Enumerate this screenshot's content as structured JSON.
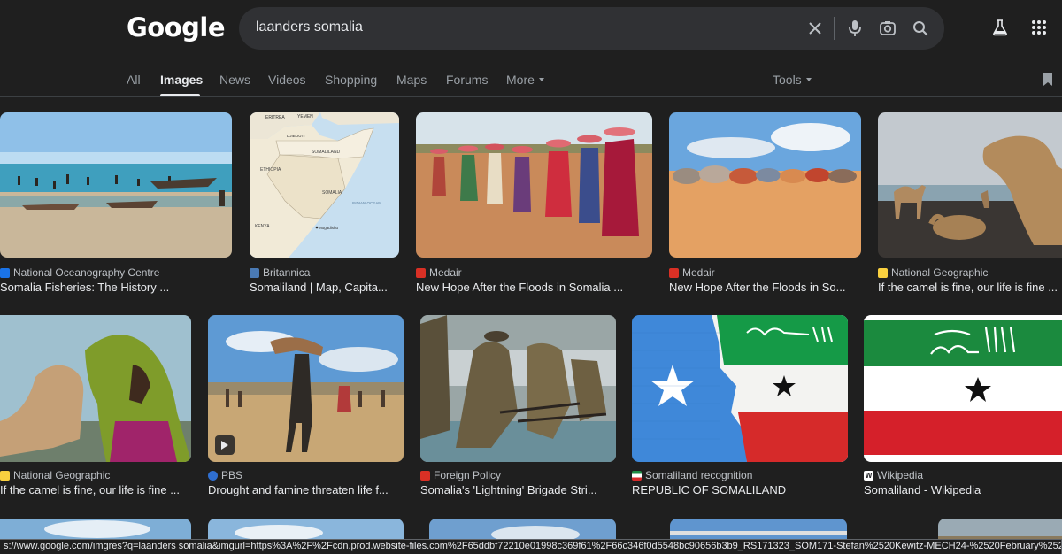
{
  "header": {
    "logo": "Google",
    "query": "laanders somalia"
  },
  "tabs": [
    {
      "label": "All"
    },
    {
      "label": "Images"
    },
    {
      "label": "News"
    },
    {
      "label": "Videos"
    },
    {
      "label": "Shopping"
    },
    {
      "label": "Maps"
    },
    {
      "label": "Forums"
    },
    {
      "label": "More"
    },
    {
      "label": "Tools"
    }
  ],
  "results": [
    {
      "source": "National Oceanography Centre",
      "title": "Somalia Fisheries: The History ...",
      "favicon_color": "#1a73e8"
    },
    {
      "source": "Britannica",
      "title": "Somaliland | Map, Capita...",
      "favicon_color": "#4a7ab5"
    },
    {
      "source": "Medair",
      "title": "New Hope After the Floods in Somalia ...",
      "favicon_color": "#d93025"
    },
    {
      "source": "Medair",
      "title": "New Hope After the Floods in So...",
      "favicon_color": "#d93025"
    },
    {
      "source": "National Geographic",
      "title": "If the camel is fine, our life is fine ...",
      "favicon_color": "#f9d03f"
    },
    {
      "source": "National Geographic",
      "title": "If the camel is fine, our life is fine ...",
      "favicon_color": "#f9d03f"
    },
    {
      "source": "PBS",
      "title": "Drought and famine threaten life f...",
      "favicon_color": "#2f6fd1"
    },
    {
      "source": "Foreign Policy",
      "title": "Somalia's 'Lightning' Brigade Stri...",
      "favicon_color": "#d93025"
    },
    {
      "source": "Somaliland recognition",
      "title": "REPUBLIC OF SOMALILAND",
      "favicon_color": "#1e8c45"
    },
    {
      "source": "Wikipedia",
      "title": "Somaliland - Wikipedia",
      "favicon_color": "#ffffff"
    }
  ],
  "map_labels": {
    "eritrea": "ERITREA",
    "yemen": "YEMEN",
    "djibouti": "DJIBOUTI",
    "somaliland": "SOMALILAND",
    "ethiopia": "ETHIOPIA",
    "somalia": "SOMALIA",
    "kenya": "KENYA",
    "indian_ocean": "INDIAN OCEAN",
    "mogadishu": "Mogadishu"
  },
  "statusbar": {
    "url": "s://www.google.com/imgres?q=laanders somalia&imgurl=https%3A%2F%2Fcdn.prod.website-files.com%2F65ddbf72210e01998c369f61%2F66c346f0d5548bc90656b3b9_RS171323_SOM171-Stefan%2520Kewitz-MECH24-%2520February%25202024-77288%2520(1).jpg&"
  }
}
